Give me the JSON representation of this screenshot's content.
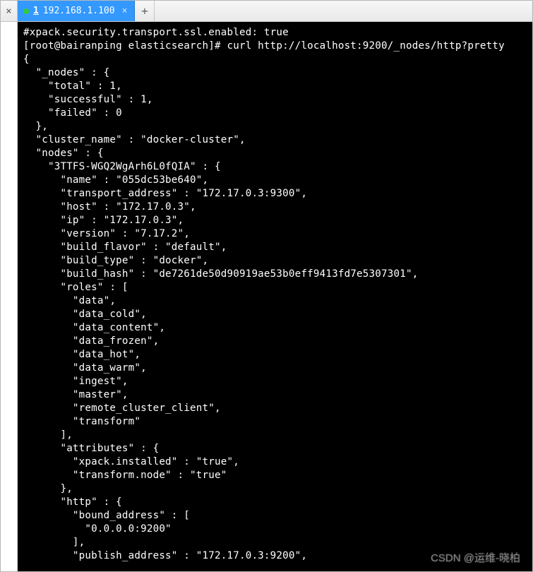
{
  "tabbar": {
    "close_icon": "×",
    "tab_index": "1",
    "tab_title": "192.168.1.100",
    "tab_close": "×",
    "add_label": "+"
  },
  "terminal": {
    "comment_line": "#xpack.security.transport.ssl.enabled: true",
    "prompt": "[root@bairanping elasticsearch]# ",
    "command": "curl http://localhost:9200/_nodes/http?pretty",
    "lines": [
      "{",
      "  \"_nodes\" : {",
      "    \"total\" : 1,",
      "    \"successful\" : 1,",
      "    \"failed\" : 0",
      "  },",
      "  \"cluster_name\" : \"docker-cluster\",",
      "  \"nodes\" : {",
      "    \"3TTFS-WGQ2WgArh6L0fQIA\" : {",
      "      \"name\" : \"055dc53be640\",",
      "      \"transport_address\" : \"172.17.0.3:9300\",",
      "      \"host\" : \"172.17.0.3\",",
      "      \"ip\" : \"172.17.0.3\",",
      "      \"version\" : \"7.17.2\",",
      "      \"build_flavor\" : \"default\",",
      "      \"build_type\" : \"docker\",",
      "      \"build_hash\" : \"de7261de50d90919ae53b0eff9413fd7e5307301\",",
      "      \"roles\" : [",
      "        \"data\",",
      "        \"data_cold\",",
      "        \"data_content\",",
      "        \"data_frozen\",",
      "        \"data_hot\",",
      "        \"data_warm\",",
      "        \"ingest\",",
      "        \"master\",",
      "        \"remote_cluster_client\",",
      "        \"transform\"",
      "      ],",
      "      \"attributes\" : {",
      "        \"xpack.installed\" : \"true\",",
      "        \"transform.node\" : \"true\"",
      "      },",
      "      \"http\" : {",
      "        \"bound_address\" : [",
      "          \"0.0.0.0:9200\"",
      "        ],",
      "        \"publish_address\" : \"172.17.0.3:9200\","
    ]
  },
  "watermark": "CSDN @运维-晓柏"
}
